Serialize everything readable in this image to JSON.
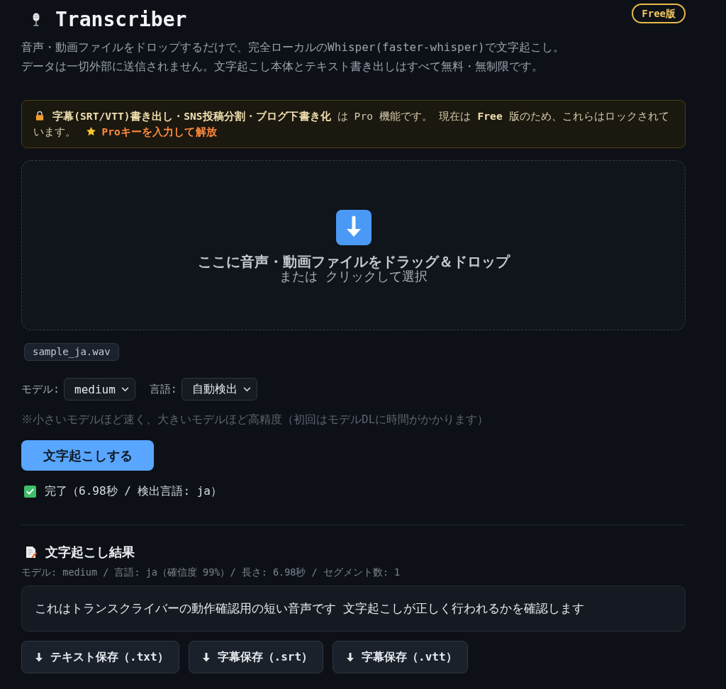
{
  "header": {
    "title": "Transcriber",
    "plan_badge": "Free版",
    "description": [
      "音声・動画ファイルをドロップするだけで、完全ローカルのWhisper(faster-whisper)で文字起こし。",
      "データは一切外部に送信されません。文字起こし本体とテキスト書き出しはすべて無料・無制限です。"
    ]
  },
  "pro_notice": {
    "text": "**字幕(SRT/VTT)書き出し・SNS投稿分割・ブログ下書き化** は Pro 機能です。 現在は **Free** 版のため、これらはロックされています。",
    "link": "Proキーを入力して解放"
  },
  "dropzone": {
    "title": "ここに音声・動画ファイルをドラッグ＆ドロップ",
    "subtitle": "または クリックして選択"
  },
  "file_chip": "sample_ja.wav",
  "options": [
    {
      "label": "モデル:",
      "value": "medium"
    },
    {
      "label": "言語:",
      "value": "自動検出"
    }
  ],
  "hint": "※小さいモデルほど速く、大きいモデルほど高精度（初回はモデルDLに時間がかかります）",
  "transcribe_button": "文字起こしする",
  "status": {
    "kind": "success",
    "text": "完了（6.98秒 / 検出言語: ja）"
  },
  "result": {
    "title": "文字起こし結果",
    "meta": "モデル: medium / 言語: ja（確信度 99%）/ 長さ: 6.98秒 / セグメント数: 1",
    "text": "これはトランスクライバーの動作確認用の短い音声です 文字起こしが正しく行われるかを確認します",
    "downloads": [
      "テキスト保存（.txt）",
      "字幕保存（.srt）",
      "字幕保存（.vtt）"
    ]
  }
}
